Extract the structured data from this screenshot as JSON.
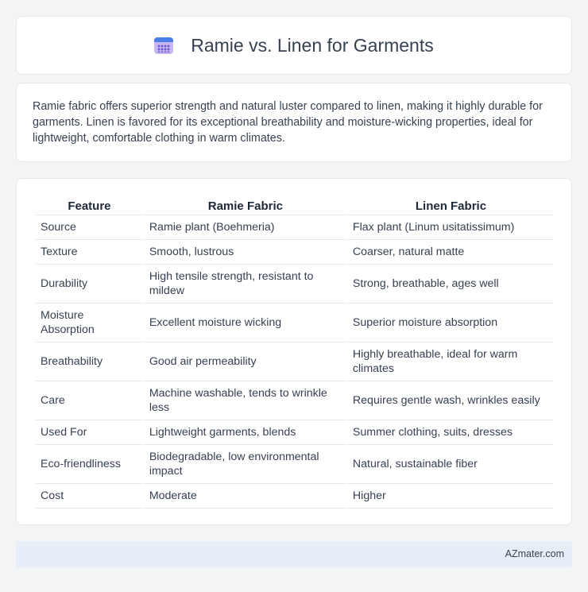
{
  "header": {
    "title": "Ramie vs. Linen for Garments",
    "icon": "calendar-icon"
  },
  "intro": "Ramie fabric offers superior strength and natural luster compared to linen, making it highly durable for garments. Linen is favored for its exceptional breathability and moisture-wicking properties, ideal for lightweight, comfortable clothing in warm climates.",
  "table": {
    "headers": [
      "Feature",
      "Ramie Fabric",
      "Linen Fabric"
    ],
    "rows": [
      [
        "Source",
        "Ramie plant (Boehmeria)",
        "Flax plant (Linum usitatissimum)"
      ],
      [
        "Texture",
        "Smooth, lustrous",
        "Coarser, natural matte"
      ],
      [
        "Durability",
        "High tensile strength, resistant to mildew",
        "Strong, breathable, ages well"
      ],
      [
        "Moisture Absorption",
        "Excellent moisture wicking",
        "Superior moisture absorption"
      ],
      [
        "Breathability",
        "Good air permeability",
        "Highly breathable, ideal for warm climates"
      ],
      [
        "Care",
        "Machine washable, tends to wrinkle less",
        "Requires gentle wash, wrinkles easily"
      ],
      [
        "Used For",
        "Lightweight garments, blends",
        "Summer clothing, suits, dresses"
      ],
      [
        "Eco-friendliness",
        "Biodegradable, low environmental impact",
        "Natural, sustainable fiber"
      ],
      [
        "Cost",
        "Moderate",
        "Higher"
      ]
    ]
  },
  "footer": {
    "brand": "AZmater.com"
  }
}
